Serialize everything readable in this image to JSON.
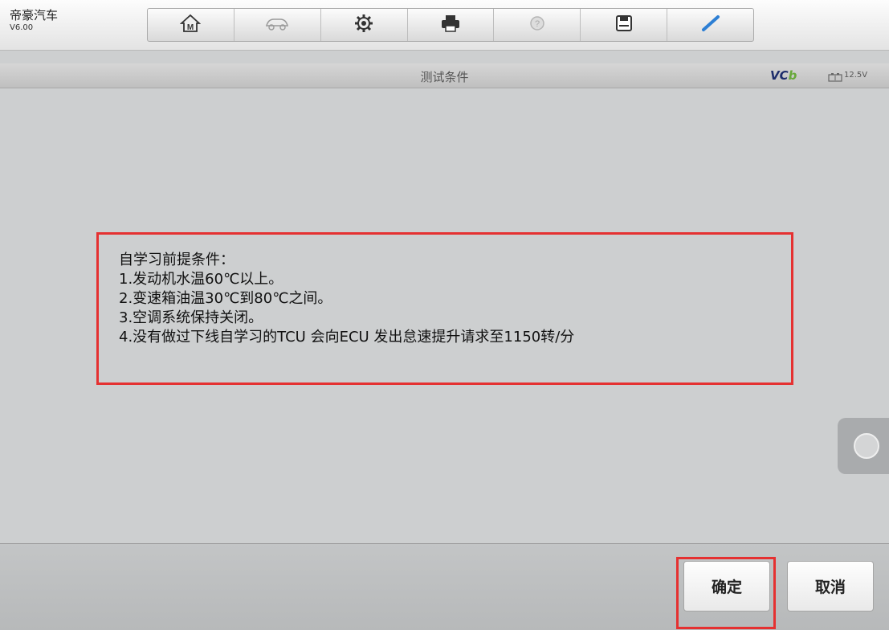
{
  "app": {
    "name": "帝豪汽车",
    "version": "V6.00"
  },
  "toolbar": {
    "buttons": [
      {
        "icon": "home-icon"
      },
      {
        "icon": "car-icon"
      },
      {
        "icon": "gear-icon"
      },
      {
        "icon": "printer-icon"
      },
      {
        "icon": "help-icon"
      },
      {
        "icon": "save-icon"
      },
      {
        "icon": "pen-icon"
      }
    ]
  },
  "header": {
    "title": "测试条件",
    "vci": "VC",
    "vci_b": "b",
    "voltage": "12.5V"
  },
  "message": {
    "lines": [
      "自学习前提条件：",
      "1.发动机水温60℃以上。",
      "2.变速箱油温30℃到80℃之间。",
      "3.空调系统保持关闭。",
      "4.没有做过下线自学习的TCU 会向ECU 发出怠速提升请求至1150转/分"
    ]
  },
  "footer": {
    "ok_label": "确定",
    "cancel_label": "取消"
  },
  "colors": {
    "highlight": "#e53131",
    "accent": "#1d2d6b",
    "vci_green": "#68a83a"
  }
}
